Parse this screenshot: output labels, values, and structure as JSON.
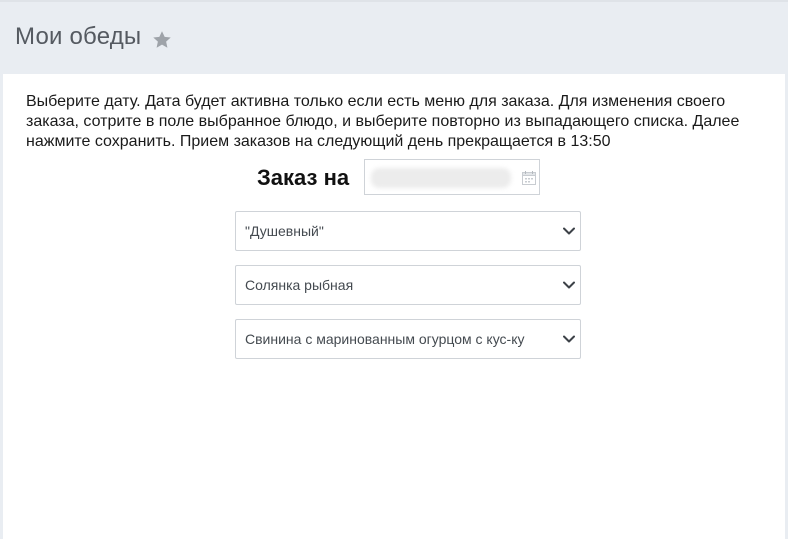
{
  "header": {
    "title": "Мои обеды",
    "favorite_icon": "star-icon"
  },
  "main": {
    "info_text": "Выберите дату. Дата будет активна только если есть меню для заказа. Для изменения своего заказа, сотрите в поле выбранное блюдо, и выберите повторно из выпадающего списка. Далее нажмите сохранить. Прием заказов на следующий день прекращается в 13:50",
    "order_label": "Заказ на",
    "date_field": {
      "value": "",
      "icon": "calendar-icon"
    },
    "selects": [
      {
        "value": "\"Душевный\""
      },
      {
        "value": "Солянка рыбная"
      },
      {
        "value": "Свинина с маринованным огурцом с кус-кус"
      }
    ]
  },
  "colors": {
    "header_bg": "#e9edf2",
    "border": "#cfd3d8",
    "title_text": "#555a61"
  }
}
